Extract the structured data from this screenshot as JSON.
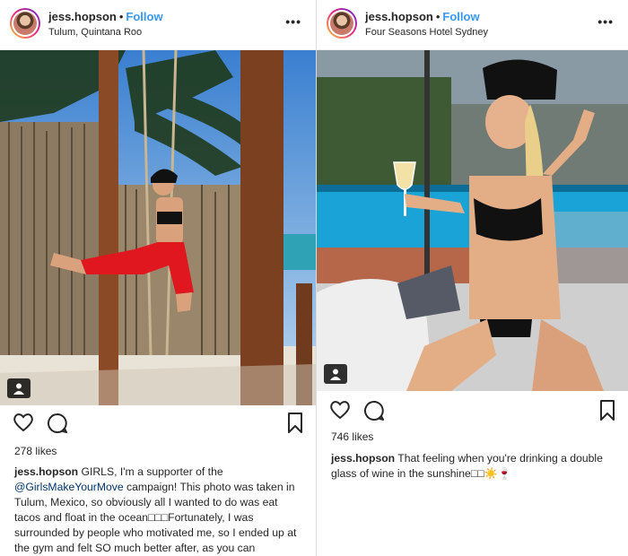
{
  "posts": [
    {
      "username": "jess.hopson",
      "follow_label": "Follow",
      "location": "Tulum, Quintana Roo",
      "likes": "278 likes",
      "caption": {
        "username": "jess.hopson",
        "pre": "GIRLS, I'm a supporter of the ",
        "mention": "@GirlsMakeYourMove",
        "post": " campaign! This photo was taken in Tulum, Mexico, so obviously all I wanted to do was eat tacos and float in the ocean□□□Fortunately, I was surrounded by people who motivated me, so I ended up at the gym and felt SO much better after, as you can"
      },
      "icons": [
        "more-icon",
        "tag-person-icon",
        "heart-icon",
        "comment-icon",
        "bookmark-icon"
      ]
    },
    {
      "username": "jess.hopson",
      "follow_label": "Follow",
      "location": "Four Seasons Hotel Sydney",
      "likes": "746 likes",
      "caption": {
        "username": "jess.hopson",
        "text": "That feeling when you're drinking a double glass of wine in the sunshine□□☀️🍷"
      },
      "icons": [
        "more-icon",
        "tag-person-icon",
        "heart-icon",
        "comment-icon",
        "bookmark-icon"
      ]
    }
  ],
  "separator": "•",
  "more_label": "•••"
}
